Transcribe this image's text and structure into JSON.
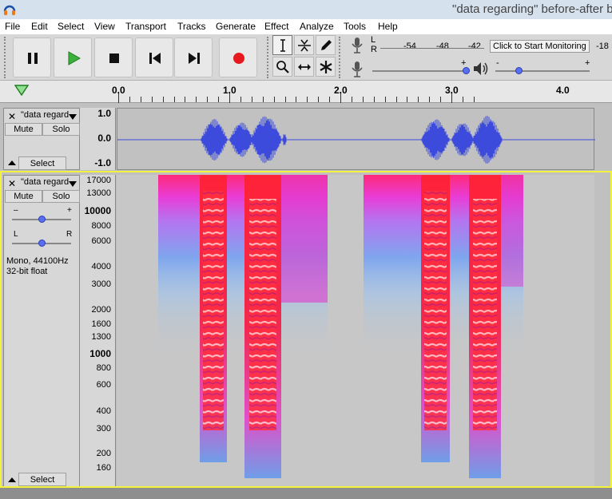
{
  "window": {
    "title": "\"data regarding\" before-after b"
  },
  "menu": [
    "File",
    "Edit",
    "Select",
    "View",
    "Transport",
    "Tracks",
    "Generate",
    "Effect",
    "Analyze",
    "Tools",
    "Help"
  ],
  "transport": {
    "pause": "pause-icon",
    "play": "play-icon",
    "stop": "stop-icon",
    "skip_start": "skip-to-start-icon",
    "skip_end": "skip-to-end-icon",
    "record": "record-icon"
  },
  "tools": [
    "selection-tool",
    "envelope-tool",
    "draw-tool",
    "zoom-tool",
    "timeshift-tool",
    "multi-tool"
  ],
  "meter": {
    "L": "L",
    "R": "R",
    "scale": [
      "-54",
      "-48",
      "-42",
      "-18"
    ],
    "monitor_label": "Click to Start Monitoring",
    "record_volume_plus": "+",
    "play_volume_minus": "-",
    "play_volume_plus": "+"
  },
  "ruler": {
    "labels": [
      "0.0",
      "1.0",
      "2.0",
      "3.0",
      "4.0"
    ]
  },
  "track1": {
    "name": "\"data regard",
    "mute": "Mute",
    "solo": "Solo",
    "select": "Select",
    "scale": [
      "1.0",
      "0.0",
      "-1.0"
    ]
  },
  "track2": {
    "name": "\"data regard",
    "mute": "Mute",
    "solo": "Solo",
    "gain_minus": "–",
    "gain_plus": "+",
    "pan_left": "L",
    "pan_right": "R",
    "info_rate": "Mono, 44100Hz",
    "info_format": "32-bit float",
    "select": "Select",
    "freq_labels": [
      "17000",
      "13000",
      "10000",
      "8000",
      "6000",
      "4000",
      "3000",
      "2000",
      "1600",
      "1300",
      "1000",
      "800",
      "600",
      "400",
      "300",
      "200",
      "160"
    ]
  },
  "colors": {
    "waveform": "#3c4bdc",
    "selection_border": "#f3f33c",
    "spectrogram_high": "#ff2440",
    "spectrogram_mid": "#e244ee",
    "spectrogram_low": "#6fa5ee"
  }
}
